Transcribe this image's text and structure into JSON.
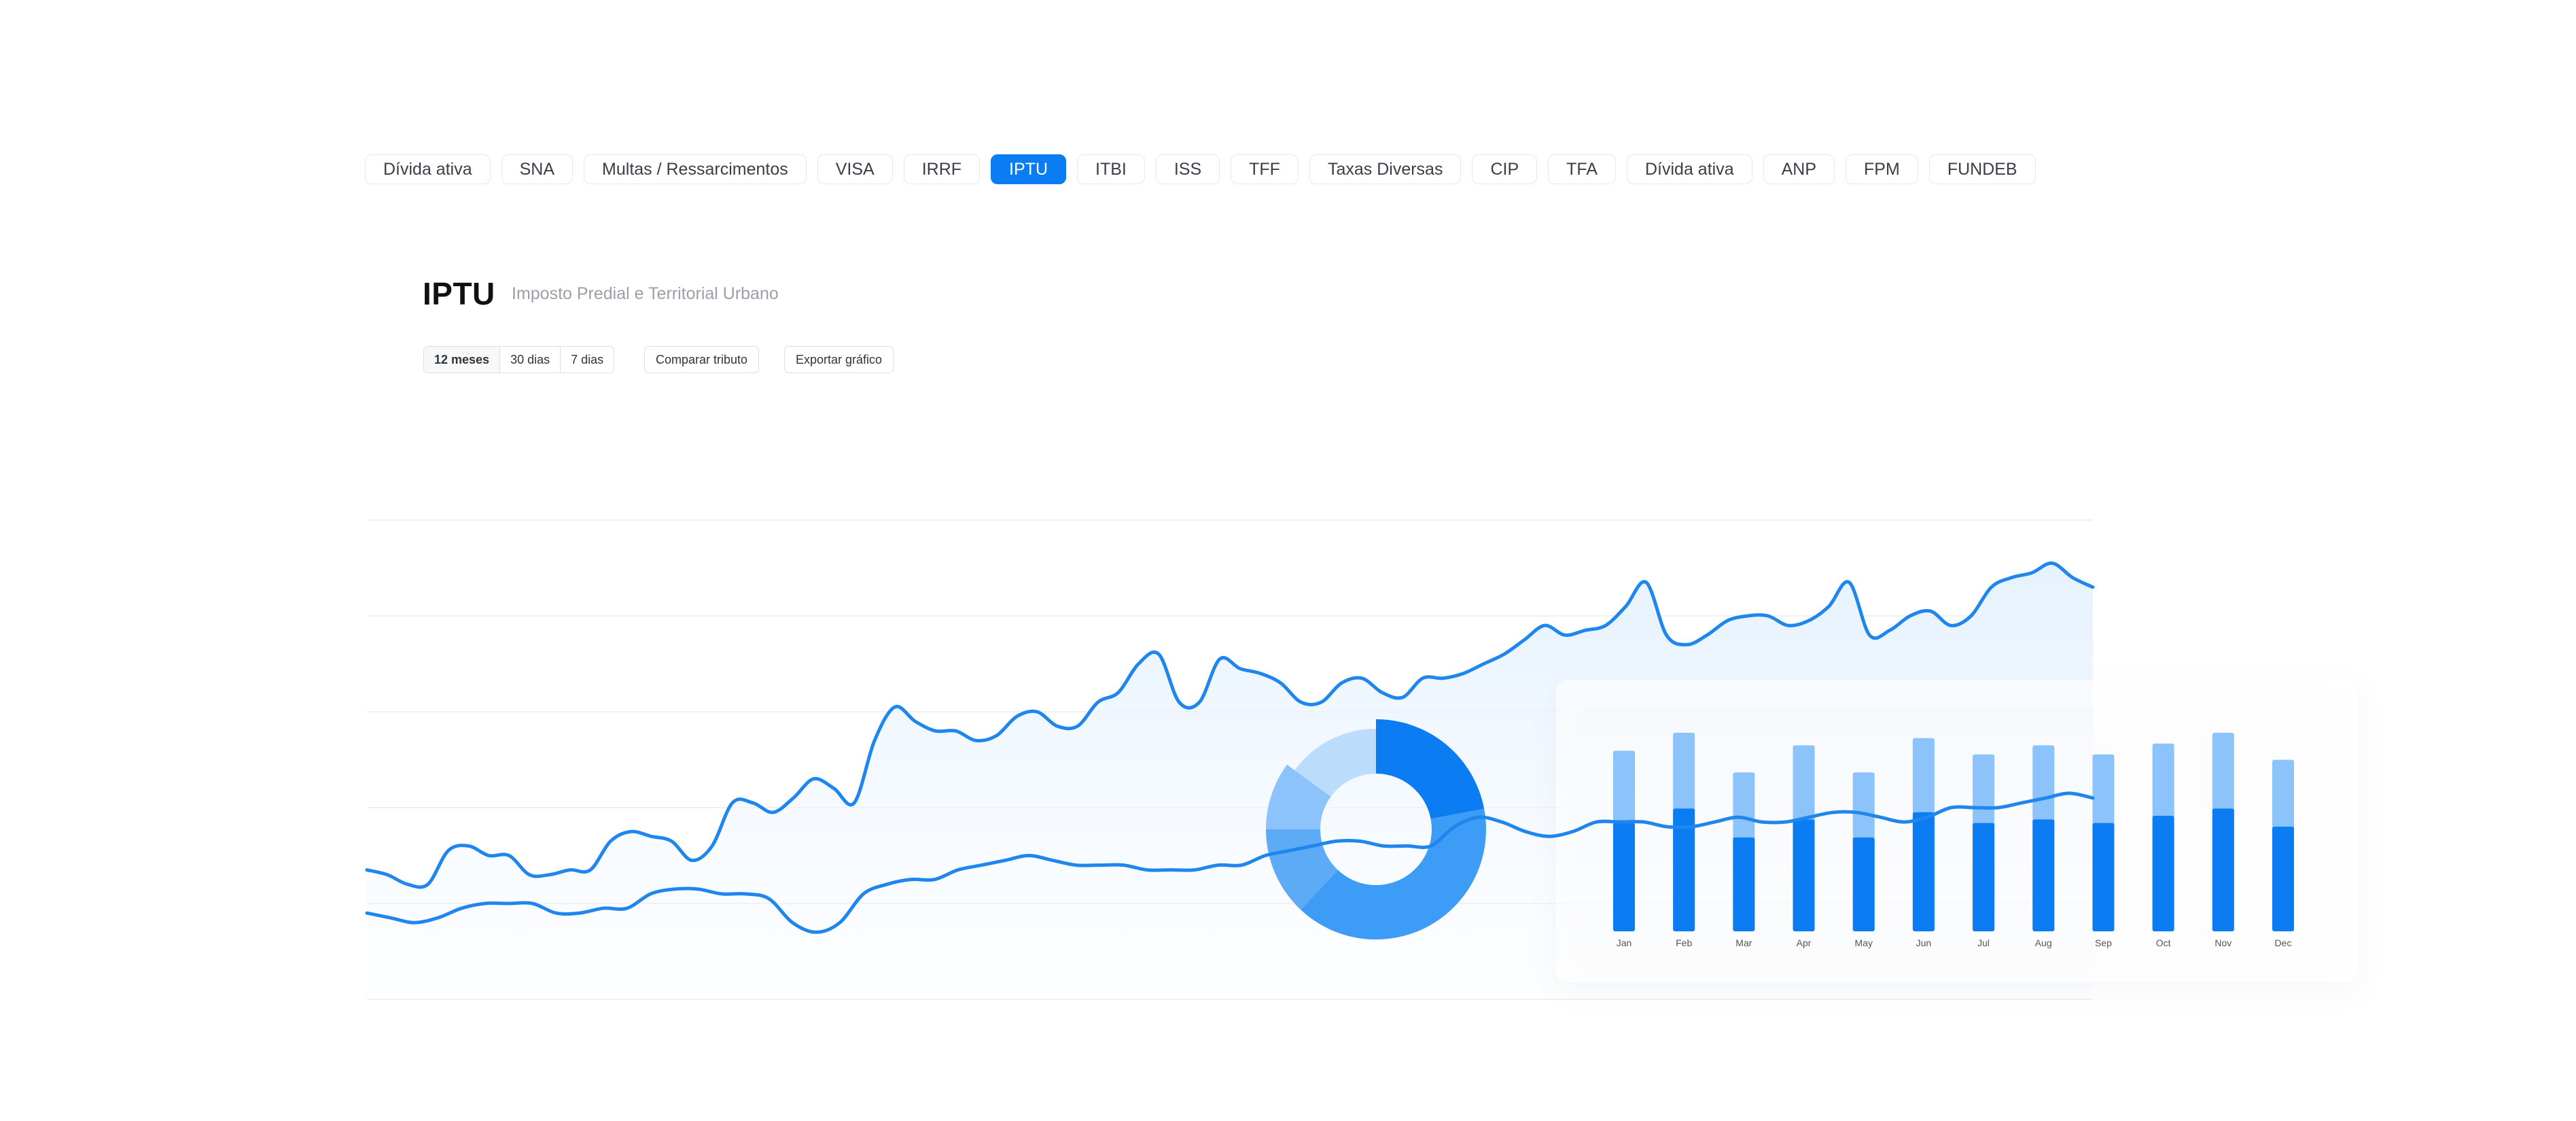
{
  "tabs": [
    {
      "label": "Dívida ativa",
      "active": false
    },
    {
      "label": "SNA",
      "active": false
    },
    {
      "label": "Multas / Ressarcimentos",
      "active": false
    },
    {
      "label": "VISA",
      "active": false
    },
    {
      "label": "IRRF",
      "active": false
    },
    {
      "label": "IPTU",
      "active": true
    },
    {
      "label": "ITBI",
      "active": false
    },
    {
      "label": "ISS",
      "active": false
    },
    {
      "label": "TFF",
      "active": false
    },
    {
      "label": "Taxas Diversas",
      "active": false
    },
    {
      "label": "CIP",
      "active": false
    },
    {
      "label": "TFA",
      "active": false
    },
    {
      "label": "Dívida ativa",
      "active": false
    },
    {
      "label": "ANP",
      "active": false
    },
    {
      "label": "FPM",
      "active": false
    },
    {
      "label": "FUNDEB",
      "active": false
    }
  ],
  "header": {
    "title": "IPTU",
    "subtitle": "Imposto Predial e Territorial Urbano"
  },
  "controls": {
    "ranges": [
      {
        "label": "12 meses",
        "active": true
      },
      {
        "label": "30 dias",
        "active": false
      },
      {
        "label": "7 dias",
        "active": false
      }
    ],
    "compare_label": "Comparar tributo",
    "export_label": "Exportar gráfico"
  },
  "colors": {
    "accent": "#0b7cf2",
    "bar_light": "#8cc3fb",
    "bar_dark": "#0b7cf2",
    "area_fill": "#eaf4fe"
  },
  "chart_data": [
    {
      "type": "line",
      "x": [
        0,
        1,
        2,
        3,
        4,
        5,
        6,
        7,
        8,
        9,
        10,
        11,
        12,
        13,
        14,
        15,
        16,
        17,
        18,
        19,
        20,
        21,
        22,
        23,
        24,
        25,
        26,
        27,
        28,
        29,
        30,
        31,
        32,
        33,
        34,
        35,
        36,
        37,
        38,
        39,
        40,
        41,
        42,
        43,
        44,
        45,
        46,
        47,
        48,
        49,
        50,
        51,
        52,
        53,
        54,
        55,
        56,
        57,
        58,
        59,
        60,
        61,
        62,
        63,
        64,
        65,
        66,
        67,
        68,
        69,
        70,
        71,
        72,
        73,
        74,
        75,
        76,
        77,
        78,
        79,
        80,
        81,
        82,
        83,
        84,
        85,
        86,
        87,
        88,
        89,
        90,
        91,
        92,
        93,
        94,
        95,
        96,
        97,
        98,
        99,
        100,
        101,
        102,
        103,
        104,
        105,
        106,
        107,
        108,
        109,
        110,
        111,
        112,
        113,
        114,
        115,
        116,
        117,
        118,
        119
      ],
      "series": [
        {
          "values": [
            27,
            26,
            24,
            24,
            31,
            32,
            30,
            30,
            26,
            26,
            27,
            27,
            33,
            35,
            34,
            33,
            29,
            32,
            41,
            41,
            39,
            42,
            46,
            44,
            41,
            54,
            61,
            58,
            56,
            56,
            54,
            55,
            59,
            60,
            57,
            57,
            62,
            64,
            70,
            72,
            62,
            62,
            71,
            69,
            68,
            66,
            62,
            62,
            66,
            67,
            64,
            63,
            67,
            67,
            68,
            70,
            72,
            75,
            78,
            76,
            77,
            78,
            82,
            87,
            76,
            74,
            76,
            79,
            80,
            80,
            78,
            79,
            82,
            87,
            76,
            77,
            80,
            81,
            78,
            80,
            86,
            88,
            89,
            91,
            88,
            86
          ]
        },
        {
          "values": [
            18,
            17,
            16,
            17,
            19,
            20,
            20,
            20,
            18,
            18,
            19,
            19,
            22,
            23,
            23,
            22,
            22,
            21,
            16,
            14,
            16,
            22,
            24,
            25,
            25,
            27,
            28,
            29,
            30,
            29,
            28,
            28,
            28,
            27,
            27,
            27,
            28,
            28,
            30,
            31,
            32,
            33,
            33,
            32,
            32,
            32,
            36,
            38,
            37,
            35,
            34,
            35,
            37,
            37,
            37,
            36,
            36,
            37,
            38,
            37,
            37,
            38,
            39,
            39,
            38,
            37,
            38,
            40,
            40,
            40,
            41,
            42,
            43,
            42
          ]
        }
      ],
      "ylim": [
        0,
        100
      ]
    },
    {
      "type": "pie",
      "values": [
        22,
        40,
        13,
        10,
        15
      ]
    },
    {
      "type": "bar",
      "categories": [
        "Jan",
        "Feb",
        "Mar",
        "Apr",
        "May",
        "Jun",
        "Jul",
        "Aug",
        "Sep",
        "Oct",
        "Nov",
        "Dec"
      ],
      "series": [
        {
          "values": [
            35,
            38,
            31,
            36,
            31,
            37,
            34,
            36,
            34,
            36,
            38,
            33
          ]
        },
        {
          "values": [
            30,
            34,
            26,
            31,
            26,
            33,
            30,
            31,
            30,
            32,
            34,
            29
          ]
        }
      ]
    }
  ]
}
